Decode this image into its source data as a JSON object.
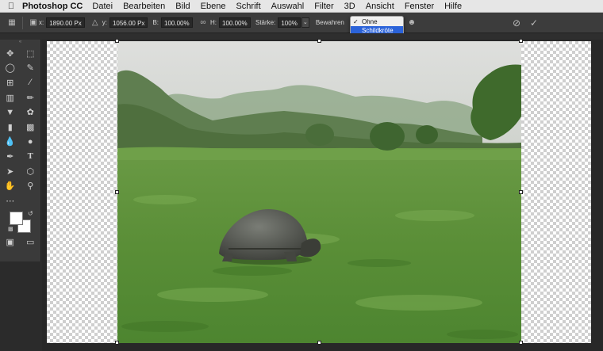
{
  "menubar": {
    "app_name": "Photoshop CC",
    "items": [
      "Datei",
      "Bearbeiten",
      "Bild",
      "Ebene",
      "Schrift",
      "Auswahl",
      "Filter",
      "3D",
      "Ansicht",
      "Fenster",
      "Hilfe"
    ]
  },
  "options": {
    "x_label": "x:",
    "x_value": "1890.00 Px",
    "y_label": "y:",
    "y_value": "1056.00 Px",
    "w_label": "B:",
    "w_value": "100.00%",
    "h_label": "H:",
    "h_value": "100.00%",
    "amount_label": "Stärke:",
    "amount_value": "100%",
    "protect_label": "Bewahren"
  },
  "protect_dropdown": {
    "options": [
      "Ohne",
      "Schildkröte"
    ],
    "checked_index": 0,
    "highlighted_index": 1
  },
  "colors": {
    "foreground": "#ffffff",
    "background": "#ffffff",
    "highlight": "#2b63d9"
  }
}
